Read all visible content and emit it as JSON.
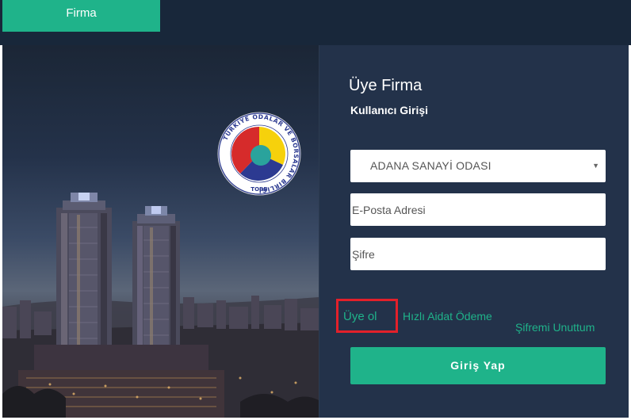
{
  "nav": {
    "tab_label": "Firma"
  },
  "logo": {
    "ring_text": "TÜRKİYE ODALAR VE BORSALAR BİRLİĞİ",
    "abbr": "TOBB",
    "colors": {
      "yellow": "#f6d10c",
      "red": "#d62b2b",
      "blue": "#2c3a91",
      "teal": "#2aa39c"
    }
  },
  "login": {
    "title": "Üye Firma",
    "subtitle": "Kullanıcı Girişi",
    "chamber_select": {
      "value": "ADANA SANAYİ ODASI"
    },
    "email_placeholder": "E-Posta Adresi",
    "password_placeholder": "Şifre",
    "register_link": "Üye ol",
    "fast_payment_link": "Hızlı Aidat Ödeme",
    "forgot_password_link": "Şifremi Unuttum",
    "submit_label": "Giriş Yap"
  },
  "colors": {
    "accent": "#1fb38a",
    "header_bg": "#18273a",
    "panel_bg": "#23324a",
    "highlight": "#e3202a"
  }
}
